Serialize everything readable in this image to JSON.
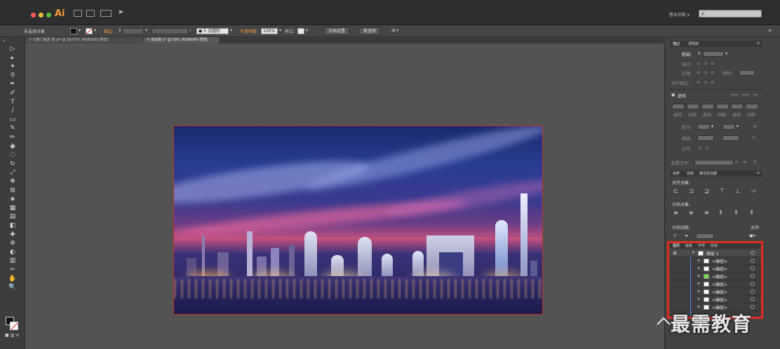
{
  "titlebar": {
    "app_name": "Ai",
    "workspace": "基本功能 ▾",
    "search_placeholder": "ρ"
  },
  "controlbar": {
    "selection_status": "未选择对象",
    "stroke_label": "描边:",
    "stroke_size": "5 点圆形",
    "opacity_label": "不透明度:",
    "opacity_value": "100%",
    "style_label": "样式:",
    "doc_setup_button": "文档设置",
    "preferences_button": "首选项"
  },
  "tabs": [
    {
      "label": "× 七体门是否-定.ai* @ 16.67% (RGB/GPU 预览)"
    },
    {
      "label": "× 未标题-1* @ 50% (RGB/GPU 预览)"
    }
  ],
  "tools": [
    "▷",
    "▸",
    "✦",
    "⚲",
    "✒",
    "✐",
    "T",
    "/",
    "▭",
    "✎",
    "✏",
    "◉",
    "◌",
    "↻",
    "⤢",
    "✥",
    "⊞",
    "◈",
    "▦",
    "▤",
    "◧",
    "✚",
    "⊗",
    "◐",
    "▥",
    "✂",
    "✋",
    "🔍"
  ],
  "stroke_panel": {
    "tabs": [
      "描边",
      "透明度"
    ],
    "weight_label": "粗细:",
    "cap_label": "端点:",
    "corner_label": "边角:",
    "limit_label": "限制:",
    "align_label": "对齐描边:",
    "dashed_label": "虚线",
    "dash_labels": [
      "虚线",
      "间隙",
      "虚线",
      "间隙",
      "虚线",
      "间隙"
    ],
    "arrow_label": "箭头:",
    "scale_label": "缩放:",
    "align2_label": "对齐:",
    "profile_label": "配置文件:"
  },
  "align_panel": {
    "tabs": [
      "对齐",
      "变换",
      "路径查找器"
    ],
    "align_objects_label": "对齐对象:",
    "distribute_objects_label": "分布对象:",
    "distribute_spacing_label": "分布间距:",
    "align_to_label": "对齐:"
  },
  "layers_panel": {
    "tabs": [
      "图层",
      "画板",
      "字符",
      "段落"
    ],
    "rows": [
      {
        "name": "图层 1",
        "thumb_color": "#ffffff",
        "top_level": true
      },
      {
        "name": "<编组>",
        "thumb_color": "#ffffff",
        "top_level": false
      },
      {
        "name": "<编组>",
        "thumb_color": "#ffffff",
        "top_level": false
      },
      {
        "name": "<编组>",
        "thumb_color": "#7dd84a",
        "top_level": false
      },
      {
        "name": "<编组>",
        "thumb_color": "#ffffff",
        "top_level": false
      },
      {
        "name": "<编组>",
        "thumb_color": "#ffffff",
        "top_level": false
      },
      {
        "name": "<编组>",
        "thumb_color": "#ffffff",
        "top_level": false
      },
      {
        "name": "<编组>",
        "thumb_color": "#ffffff",
        "top_level": false
      }
    ]
  },
  "watermark": "最需教育",
  "colors": {
    "highlight_frame": "#e02b20",
    "layer_color": "#4a8ee6",
    "ai_brand": "#f39a36"
  }
}
